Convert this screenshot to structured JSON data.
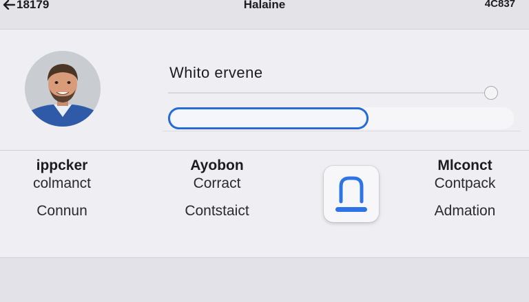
{
  "nav": {
    "back_label": "18179",
    "title": "Halaine",
    "status": "4C837"
  },
  "profile": {
    "heading": "Whito ervene",
    "progress": 0.58,
    "slider_level": 1.0
  },
  "contacts": [
    {
      "title": "ippcker",
      "subtitle": "colmanct",
      "detail": "Connun"
    },
    {
      "title": "Ayobon",
      "subtitle": "Corract",
      "detail": "Contstaict"
    },
    {
      "title": "Mlconct",
      "subtitle": "Contpack",
      "detail": "Admation"
    }
  ],
  "icons": {
    "back": "arrow-left-icon",
    "app": "lock-icon"
  },
  "colors": {
    "accent": "#2e74e6",
    "background": "#efeff3",
    "topbar": "#e3e3e8"
  }
}
